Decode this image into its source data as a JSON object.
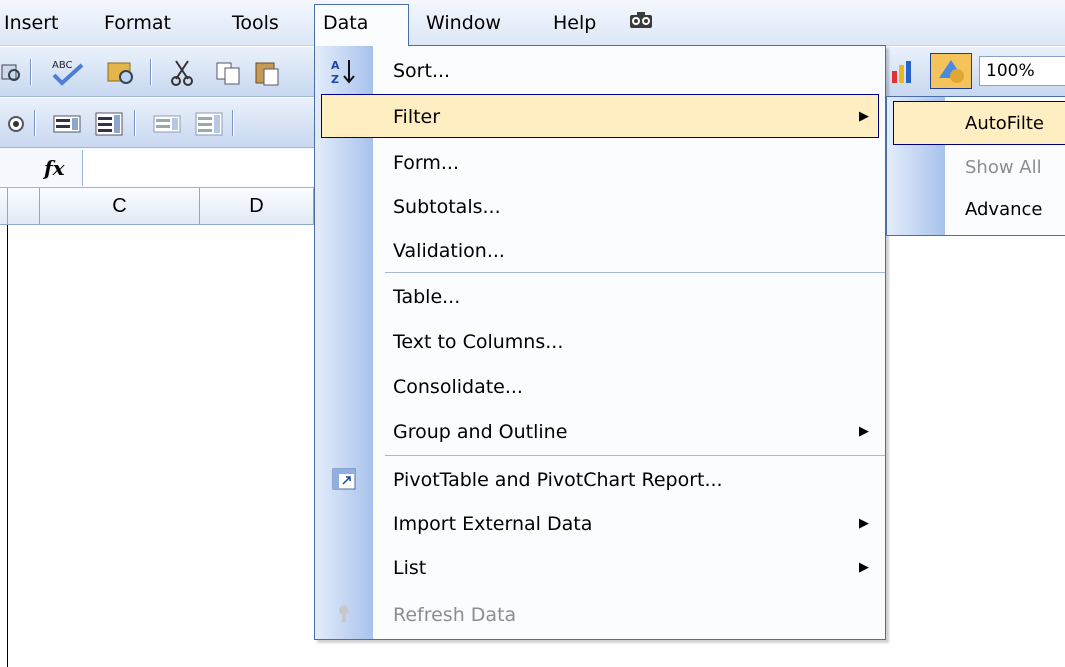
{
  "menubar": {
    "insert": "Insert",
    "format": "Format",
    "tools": "Tools",
    "data": "Data",
    "window": "Window",
    "help": "Help",
    "camera_icon": "camera-icon"
  },
  "toolbar": {
    "zoom": "100%"
  },
  "formula_bar": {
    "fx_label": "fx",
    "value": ""
  },
  "columns": [
    "C",
    "D"
  ],
  "data_menu": {
    "items": [
      {
        "label": "Sort...",
        "icon": "sort-az-icon"
      },
      {
        "label": "Filter",
        "submenu": true,
        "highlighted": true
      },
      {
        "label": "Form..."
      },
      {
        "label": "Subtotals..."
      },
      {
        "label": "Validation..."
      },
      {
        "label": "Table..."
      },
      {
        "label": "Text to Columns..."
      },
      {
        "label": "Consolidate..."
      },
      {
        "label": "Group and Outline",
        "submenu": true
      },
      {
        "label": "PivotTable and PivotChart Report...",
        "icon": "pivot-table-icon"
      },
      {
        "label": "Import External Data",
        "submenu": true
      },
      {
        "label": "List",
        "submenu": true
      },
      {
        "label": "Refresh Data",
        "icon": "refresh-icon",
        "disabled": true
      }
    ]
  },
  "filter_submenu": {
    "items": [
      {
        "label": "AutoFilte",
        "highlighted": true
      },
      {
        "label": "Show All",
        "disabled": true
      },
      {
        "label": "Advance"
      }
    ]
  },
  "colors": {
    "highlight": "#ffeec2",
    "highlight_border": "#000080",
    "menu_border": "#4a6ea9",
    "gutter": "#a8c2ec"
  }
}
